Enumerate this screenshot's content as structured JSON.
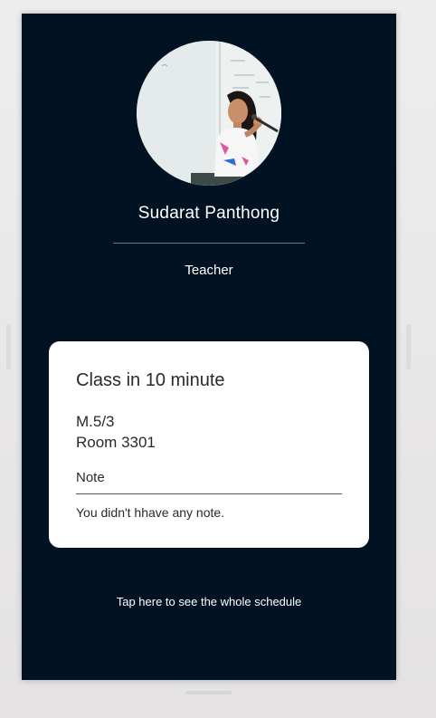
{
  "profile": {
    "name": "Sudarat Panthong",
    "role": "Teacher",
    "avatar_icon": "teacher-photo"
  },
  "class_card": {
    "heading": "Class in 10 minute",
    "class_name": "M.5/3",
    "room": "Room 3301",
    "note_label": "Note",
    "note_text": "You didn't hhave any note."
  },
  "footer": {
    "schedule_link": "Tap here to see the whole schedule"
  },
  "colors": {
    "background": "#011322",
    "card": "#ffffff",
    "text_light": "#ffffff",
    "text_dark": "#2a2a2a"
  }
}
